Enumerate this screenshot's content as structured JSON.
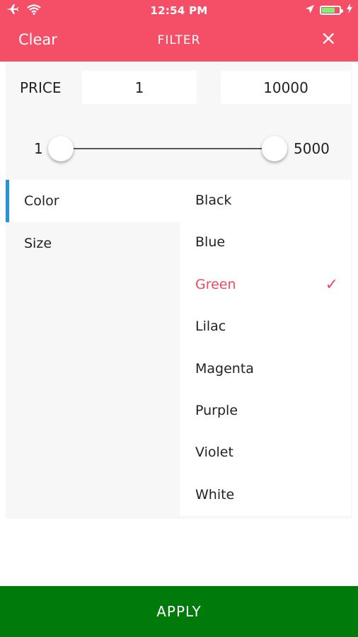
{
  "status_bar": {
    "time": "12:54 PM",
    "icons": [
      "airplane-icon",
      "wifi-icon",
      "location-arrow-icon",
      "battery-icon",
      "charging-bolt-icon"
    ]
  },
  "header": {
    "clear_label": "Clear",
    "title": "FILTER",
    "close_icon": "×"
  },
  "price": {
    "label": "PRICE",
    "min_value": "1",
    "max_value": "10000",
    "slider_min_label": "1",
    "slider_max_label": "5000"
  },
  "categories": [
    {
      "label": "Color",
      "active": true
    },
    {
      "label": "Size",
      "active": false
    }
  ],
  "options": [
    {
      "label": "Black",
      "selected": false
    },
    {
      "label": "Blue",
      "selected": false
    },
    {
      "label": "Green",
      "selected": true
    },
    {
      "label": "Lilac",
      "selected": false
    },
    {
      "label": "Magenta",
      "selected": false
    },
    {
      "label": "Purple",
      "selected": false
    },
    {
      "label": "Violet",
      "selected": false
    },
    {
      "label": "White",
      "selected": false
    }
  ],
  "check_mark": "✓",
  "apply_label": "APPLY",
  "colors": {
    "header_bg": "#f44f67",
    "accent_pink": "#ef4a62",
    "active_indicator": "#2496d8",
    "apply_bg": "#007a0b"
  }
}
